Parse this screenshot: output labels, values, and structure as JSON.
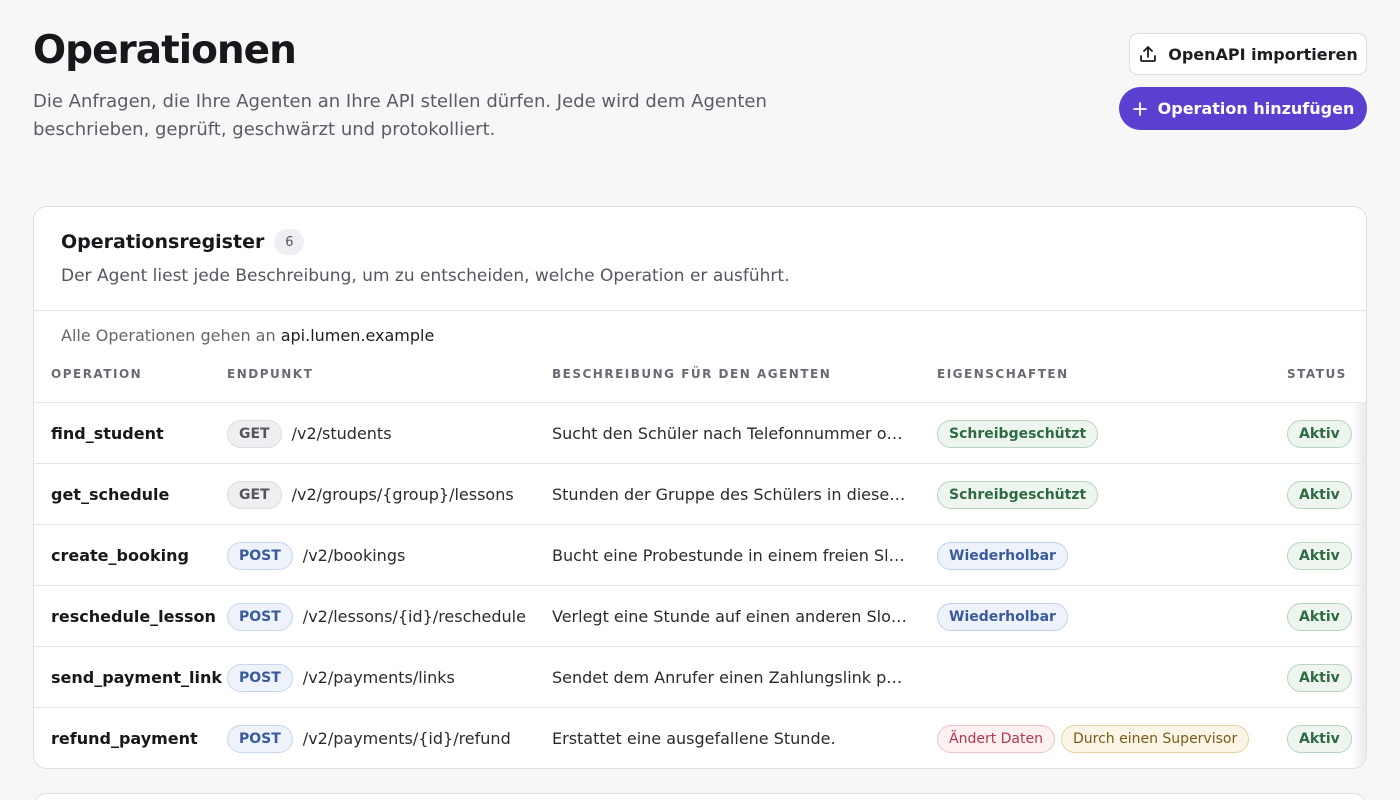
{
  "header": {
    "title": "Operationen",
    "description": "Die Anfragen, die Ihre Agenten an Ihre API stellen dürfen. Jede wird dem Agenten beschrieben, geprüft, geschwärzt und protokolliert.",
    "import_label": "OpenAPI importieren",
    "import_icon": "upload-icon",
    "add_label": "Operation hinzufügen",
    "add_icon": "plus-icon",
    "accent_color": "#5b3fd0"
  },
  "registry": {
    "title": "Operationsregister",
    "count": "6",
    "subtitle": "Der Agent liest jede Beschreibung, um zu entscheiden, welche Operation er ausführt.",
    "host_prefix": "Alle Operationen gehen an",
    "host": "api.lumen.example",
    "columns": {
      "operation": "Operation",
      "endpoint": "Endpunkt",
      "description": "Beschreibung für den Agenten",
      "properties": "Eigenschaften",
      "status": "Status"
    },
    "rows": [
      {
        "name": "find_student",
        "method": "GET",
        "path": "/v2/students",
        "description": "Sucht den Schüler nach Telefonnummer oder...",
        "tags": [
          {
            "label": "Schreibgeschützt",
            "color": "green"
          }
        ],
        "status": "Aktiv"
      },
      {
        "name": "get_schedule",
        "method": "GET",
        "path": "/v2/groups/{group}/lessons",
        "description": "Stunden der Gruppe des Schülers in dieser W...",
        "tags": [
          {
            "label": "Schreibgeschützt",
            "color": "green"
          }
        ],
        "status": "Aktiv"
      },
      {
        "name": "create_booking",
        "method": "POST",
        "path": "/v2/bookings",
        "description": "Bucht eine Probestunde in einem freien Slot.",
        "tags": [
          {
            "label": "Wiederholbar",
            "color": "blue"
          }
        ],
        "status": "Aktiv"
      },
      {
        "name": "reschedule_lesson",
        "method": "POST",
        "path": "/v2/lessons/{id}/reschedule",
        "description": "Verlegt eine Stunde auf einen anderen Slot d...",
        "tags": [
          {
            "label": "Wiederholbar",
            "color": "blue"
          }
        ],
        "status": "Aktiv"
      },
      {
        "name": "send_payment_link",
        "method": "POST",
        "path": "/v2/payments/links",
        "description": "Sendet dem Anrufer einen Zahlungslink per N...",
        "tags": [],
        "status": "Aktiv"
      },
      {
        "name": "refund_payment",
        "method": "POST",
        "path": "/v2/payments/{id}/refund",
        "description": "Erstattet eine ausgefallene Stunde.",
        "tags": [
          {
            "label": "Ändert Daten",
            "color": "red"
          },
          {
            "label": "Durch einen Supervisor",
            "color": "amber"
          }
        ],
        "status": "Aktiv"
      }
    ]
  }
}
